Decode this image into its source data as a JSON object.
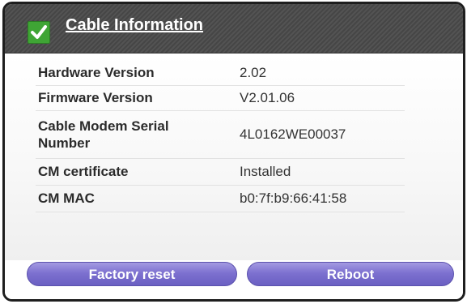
{
  "panel": {
    "title": "Cable Information",
    "header_icon": "green-checkmark"
  },
  "info_rows": [
    {
      "label": "Hardware Version",
      "value": "2.02"
    },
    {
      "label": "Firmware Version",
      "value": "V2.01.06"
    },
    {
      "label": "Cable Modem Serial Number",
      "value": "4L0162WE00037"
    },
    {
      "label": "CM certificate",
      "value": "Installed"
    },
    {
      "label": "CM MAC",
      "value": "b0:7f:b9:66:41:58"
    }
  ],
  "buttons": {
    "factory_reset": "Factory reset",
    "reboot": "Reboot"
  },
  "colors": {
    "header_bg": "#4a4a4a",
    "check_green": "#3fa535",
    "button_purple": "#7d71d0"
  }
}
